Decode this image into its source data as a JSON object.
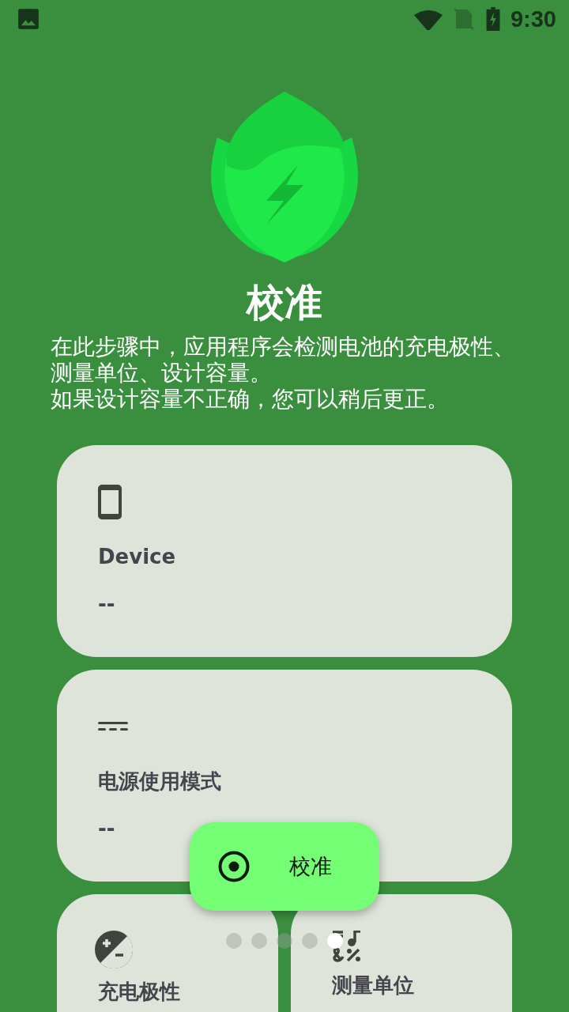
{
  "status_bar": {
    "time": "9:30"
  },
  "title": "校准",
  "description_lines": [
    "在此步骤中，应用程序会检测电池的充电极性、",
    "测量单位、设计容量。",
    "如果设计容量不正确，您可以稍后更正。"
  ],
  "cards": [
    {
      "kind": "device",
      "label": "Device",
      "value": "--"
    },
    {
      "kind": "power",
      "label": "电源使用模式",
      "value": "--"
    }
  ],
  "small_cards": [
    {
      "kind": "polarity",
      "label": "充电极性"
    },
    {
      "kind": "units",
      "label": "测量单位"
    }
  ],
  "fab": {
    "label": "校准"
  },
  "page_dots": [
    {
      "selected": false
    },
    {
      "selected": false
    },
    {
      "selected": false
    },
    {
      "selected": false
    },
    {
      "selected": true
    }
  ]
}
